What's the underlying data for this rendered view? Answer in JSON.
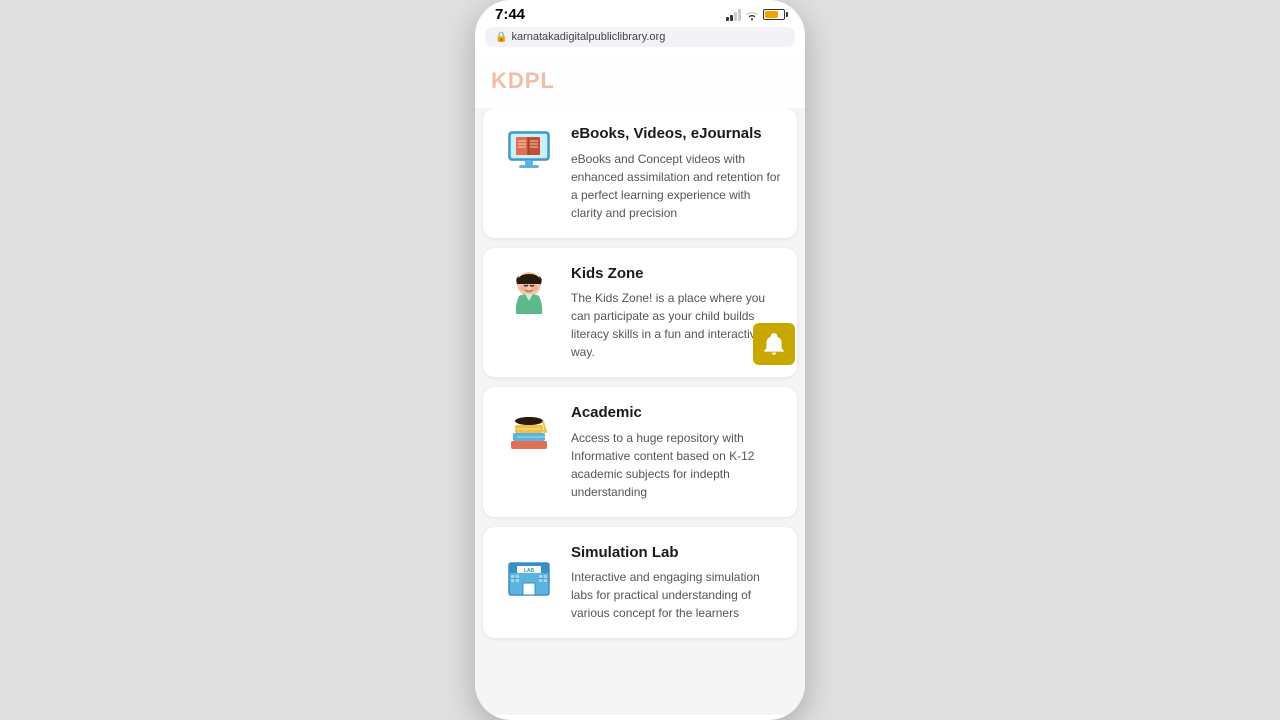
{
  "statusBar": {
    "time": "7:44",
    "url": "karnatakadigitalpubliclibrary.org"
  },
  "header": {
    "title": "KDPL"
  },
  "cards": [
    {
      "id": "ebooks",
      "title": "eBooks, Videos, eJournals",
      "description": "eBooks and Concept videos with enhanced assimilation and retention for a perfect learning experience with clarity and precision",
      "iconType": "ebooks"
    },
    {
      "id": "kids-zone",
      "title": "Kids Zone",
      "description": "The Kids Zone! is a place where you can participate as your child builds literacy skills in a fun and interactive way.",
      "iconType": "kids"
    },
    {
      "id": "academic",
      "title": "Academic",
      "description": "Access to a huge repository with Informative content based on K-12 academic subjects for indepth understanding",
      "iconType": "academic"
    },
    {
      "id": "simulation-lab",
      "title": "Simulation Lab",
      "description": "Interactive and engaging simulation labs for practical understanding of various concept for the learners",
      "iconType": "simulation"
    }
  ],
  "notification": {
    "label": "bell"
  }
}
